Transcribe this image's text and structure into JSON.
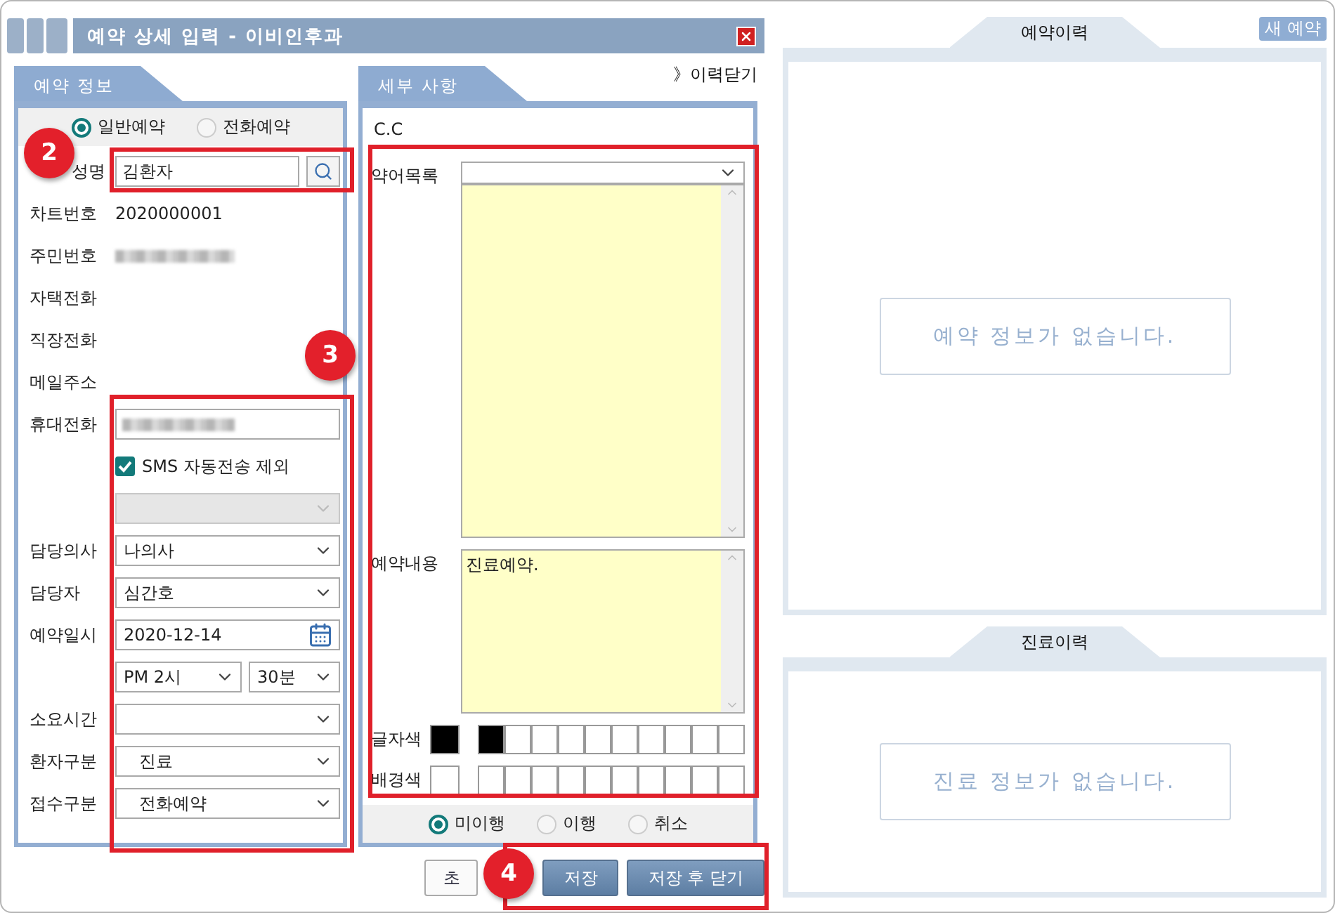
{
  "dialog": {
    "title": "예약 상세 입력 - 이비인후과"
  },
  "info_panel": {
    "tab": "예약 정보",
    "visit_types": [
      {
        "label": "일반예약",
        "selected": true
      },
      {
        "label": "전화예약",
        "selected": false
      }
    ],
    "fields": [
      {
        "kind": "search",
        "label": "성명",
        "value": "김환자"
      },
      {
        "kind": "text",
        "label": "차트번호",
        "value": "2020000001"
      },
      {
        "kind": "redacted",
        "label": "주민번호"
      },
      {
        "kind": "text",
        "label": "자택전화"
      },
      {
        "kind": "text",
        "label": "직장전화"
      },
      {
        "kind": "text",
        "label": "메일주소"
      },
      {
        "kind": "redacted-input",
        "label": "휴대전화"
      },
      {
        "kind": "checkbox",
        "label": "SMS 자동전송 제외",
        "checked": true
      },
      {
        "kind": "select",
        "disabled": true
      },
      {
        "kind": "select",
        "label": "담당의사",
        "value": "나의사",
        "disabled": false
      },
      {
        "kind": "select",
        "label": "담당자",
        "value": "심간호",
        "disabled": false
      },
      {
        "kind": "date",
        "label": "예약일시",
        "value": "2020-12-14"
      },
      {
        "kind": "time",
        "hour": "PM 2시",
        "minute": "30분"
      },
      {
        "kind": "select",
        "label": "소요시간",
        "disabled": false
      },
      {
        "kind": "select",
        "label": "환자구분",
        "value": "진료",
        "disabled": false
      },
      {
        "kind": "select",
        "label": "접수구분",
        "value": "전화예약",
        "disabled": false
      }
    ]
  },
  "detail_panel": {
    "tab": "세부 사항",
    "history_toggle": "》이력닫기",
    "cc": "C.C",
    "abbreviations": {
      "label": "약어목록"
    },
    "content": {
      "label": "예약내용",
      "value": "진료예약."
    },
    "text_color": {
      "label": "글자색",
      "current": {
        "color": "#000000"
      },
      "swatches": [
        {
          "color": "#000000"
        },
        {
          "color": "#ffffff"
        },
        {
          "color": "#ffffff"
        },
        {
          "color": "#ffffff"
        },
        {
          "color": "#ffffff"
        },
        {
          "color": "#ffffff"
        },
        {
          "color": "#ffffff"
        },
        {
          "color": "#ffffff"
        },
        {
          "color": "#ffffff"
        },
        {
          "color": "#ffffff"
        }
      ]
    },
    "background_color": {
      "label": "배경색",
      "current": {
        "color": "#ffffff"
      },
      "swatches": [
        {
          "color": "#ffffff"
        },
        {
          "color": "#ffffff"
        },
        {
          "color": "#ffffff"
        },
        {
          "color": "#ffffff"
        },
        {
          "color": "#ffffff"
        },
        {
          "color": "#ffffff"
        },
        {
          "color": "#ffffff"
        },
        {
          "color": "#ffffff"
        },
        {
          "color": "#ffffff"
        },
        {
          "color": "#ffffff"
        }
      ]
    },
    "statuses": [
      {
        "label": "미이행",
        "selected": true
      },
      {
        "label": "이행",
        "selected": false
      },
      {
        "label": "취소",
        "selected": false
      }
    ]
  },
  "buttons": [
    {
      "label": "초",
      "kind": "plain"
    },
    {
      "label": "저장",
      "kind": "primary"
    },
    {
      "label": "저장 후 닫기",
      "kind": "primary"
    }
  ],
  "new_reservation": "새 예약",
  "history": [
    {
      "title": "예약이력",
      "empty": "예약 정보가 없습니다."
    },
    {
      "title": "진료이력",
      "empty": "진료 정보가 없습니다."
    }
  ],
  "annotations": [
    {
      "label": "2"
    },
    {
      "label": "3"
    },
    {
      "label": "4"
    }
  ]
}
